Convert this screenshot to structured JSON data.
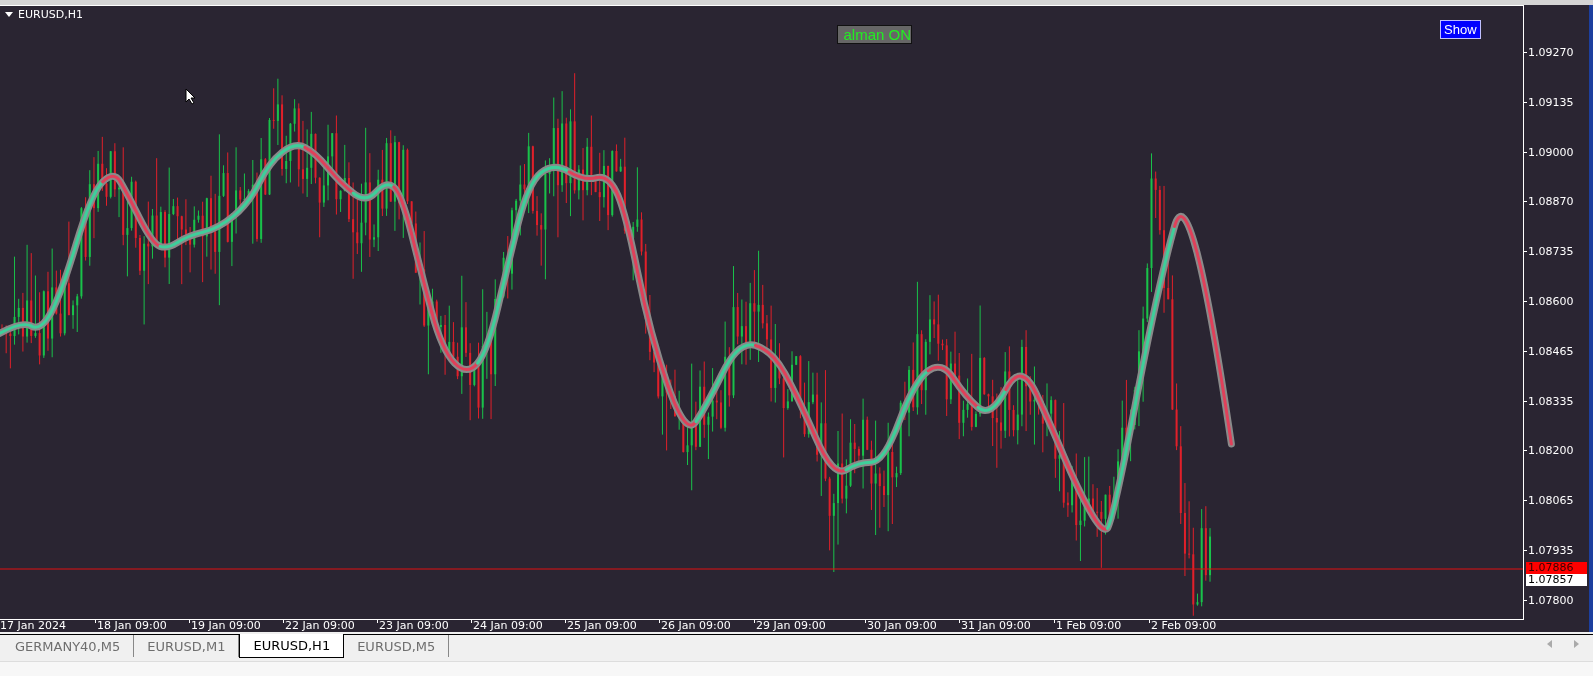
{
  "chart": {
    "title": "EURUSD,H1",
    "indicator_label": "alman ON",
    "show_button": "Show",
    "price_axis": [
      "1.09270",
      "1.09135",
      "1.09000",
      "1.08870",
      "1.08735",
      "1.08600",
      "1.08465",
      "1.08335",
      "1.08200",
      "1.08065",
      "1.07935",
      "1.07800"
    ],
    "current_price": "1.07886",
    "bid_price": "1.07857",
    "time_axis": [
      "17 Jan 2024",
      "18 Jan 09:00",
      "19 Jan 09:00",
      "22 Jan 09:00",
      "23 Jan 09:00",
      "24 Jan 09:00",
      "25 Jan 09:00",
      "26 Jan 09:00",
      "29 Jan 09:00",
      "30 Jan 09:00",
      "31 Jan 09:00",
      "1 Feb 09:00",
      "2 Feb 09:00"
    ]
  },
  "tabs": [
    {
      "label": "GERMANY40,M5",
      "selected": false
    },
    {
      "label": "EURUSD,M1",
      "selected": false
    },
    {
      "label": "EURUSD,H1",
      "selected": true
    },
    {
      "label": "EURUSD,M5",
      "selected": false
    }
  ]
}
